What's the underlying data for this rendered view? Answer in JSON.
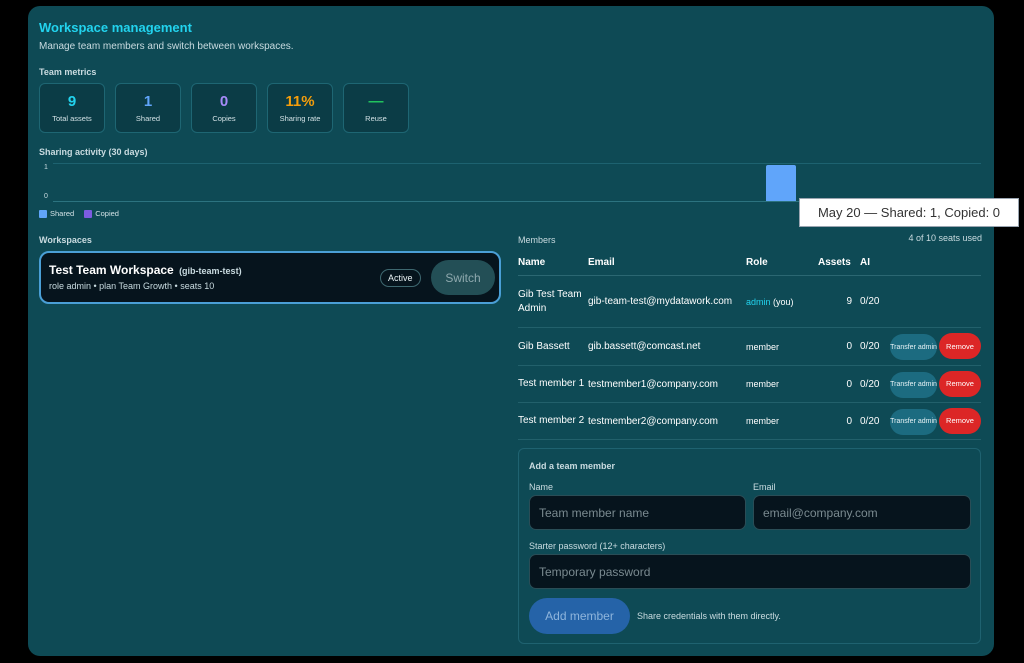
{
  "header": {
    "title": "Workspace management",
    "subtitle": "Manage team members and switch between workspaces."
  },
  "metrics": {
    "section_label": "Team metrics",
    "items": [
      {
        "value": "9",
        "label": "Total assets",
        "color": "#22d3ee"
      },
      {
        "value": "1",
        "label": "Shared",
        "color": "#60a5fa"
      },
      {
        "value": "0",
        "label": "Copies",
        "color": "#a78bfa"
      },
      {
        "value": "11%",
        "label": "Sharing rate",
        "color": "#f59e0b"
      },
      {
        "value": "—",
        "label": "Reuse",
        "color": "#22c55e"
      }
    ]
  },
  "activity": {
    "section_label": "Sharing activity (30 days)",
    "tooltip": "May 20 — Shared: 1, Copied: 0",
    "legend": [
      {
        "label": "Shared",
        "color": "#60a5fa"
      },
      {
        "label": "Copied",
        "color": "#7c5ce0"
      }
    ]
  },
  "chart_data": {
    "type": "bar",
    "title": "Sharing activity (30 days)",
    "yticks": [
      "1",
      "0"
    ],
    "ylim": [
      0,
      1
    ],
    "series": [
      {
        "name": "Shared",
        "values_by_date": {
          "May 20": 1
        },
        "color": "#60a5fa"
      },
      {
        "name": "Copied",
        "values_by_date": {
          "May 20": 0
        },
        "color": "#7c5ce0"
      }
    ],
    "highlight_date": "May 20",
    "grid": true,
    "legend_position": "bottom-left"
  },
  "workspaces": {
    "section_label": "Workspaces",
    "items": [
      {
        "name": "Test Team Workspace",
        "slug": "(gib-team-test)",
        "meta": "role admin • plan Team Growth • seats 10",
        "badge": "Active",
        "switch_label": "Switch"
      }
    ]
  },
  "members": {
    "section_label": "Members",
    "seats": "4 of 10 seats used",
    "columns": [
      "Name",
      "Email",
      "Role",
      "Assets",
      "AI"
    ],
    "transfer_label": "Transfer admin",
    "remove_label": "Remove",
    "rows": [
      {
        "name": "Gib Test Team Admin",
        "email": "gib-team-test@mydatawork.com",
        "role": "admin",
        "role_suffix": "(you)",
        "assets": "9",
        "ai": "0/20"
      },
      {
        "name": "Gib Bassett",
        "email": "gib.bassett@comcast.net",
        "role": "member",
        "role_suffix": "",
        "assets": "0",
        "ai": "0/20"
      },
      {
        "name": "Test member 1",
        "email": "testmember1@company.com",
        "role": "member",
        "role_suffix": "",
        "assets": "0",
        "ai": "0/20"
      },
      {
        "name": "Test member 2",
        "email": "testmember2@company.com",
        "role": "member",
        "role_suffix": "",
        "assets": "0",
        "ai": "0/20"
      }
    ]
  },
  "add_member": {
    "title": "Add a team member",
    "name_label": "Name",
    "name_placeholder": "Team member name",
    "email_label": "Email",
    "email_placeholder": "email@company.com",
    "password_label": "Starter password (12+ characters)",
    "password_placeholder": "Temporary password",
    "button_label": "Add member",
    "hint": "Share credentials with them directly."
  }
}
